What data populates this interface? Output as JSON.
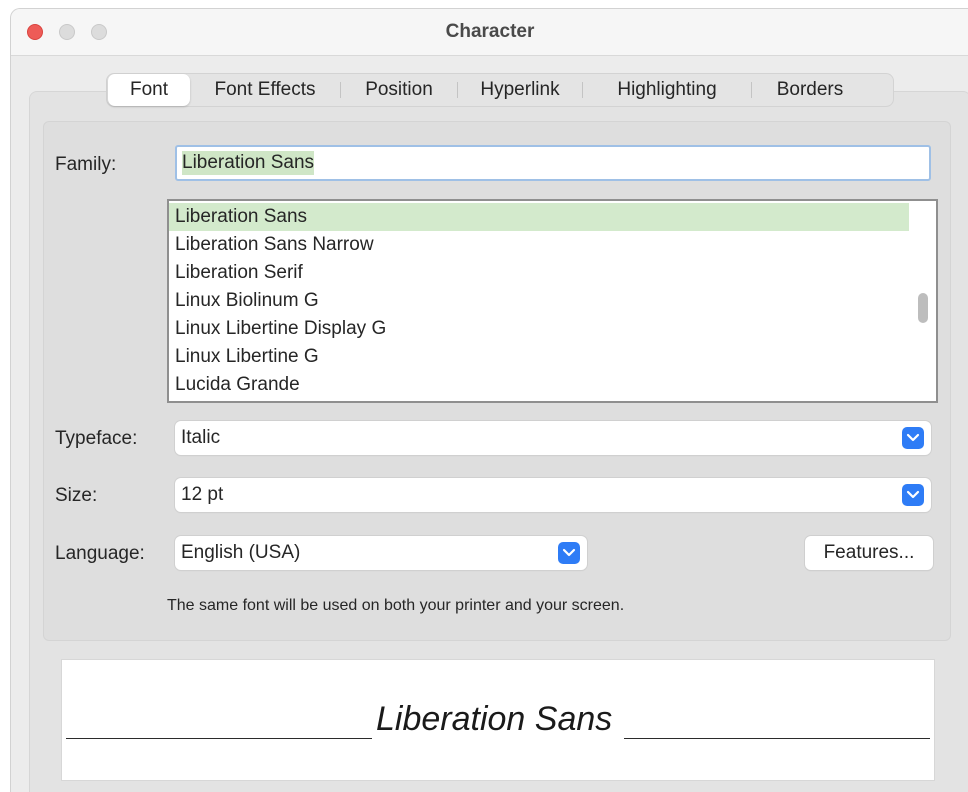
{
  "window": {
    "title": "Character"
  },
  "tabs": [
    {
      "label": "Font",
      "active": true
    },
    {
      "label": "Font Effects",
      "active": false
    },
    {
      "label": "Position",
      "active": false
    },
    {
      "label": "Hyperlink",
      "active": false
    },
    {
      "label": "Highlighting",
      "active": false
    },
    {
      "label": "Borders",
      "active": false
    }
  ],
  "family": {
    "label": "Family:",
    "value": "Liberation Sans",
    "list": [
      "Liberation Sans",
      "Liberation Sans Narrow",
      "Liberation Serif",
      "Linux Biolinum G",
      "Linux Libertine Display G",
      "Linux Libertine G",
      "Lucida Grande"
    ],
    "selected_index": 0
  },
  "typeface": {
    "label": "Typeface:",
    "value": "Italic"
  },
  "size": {
    "label": "Size:",
    "value": "12 pt"
  },
  "language": {
    "label": "Language:",
    "value": "English (USA)"
  },
  "features_button": "Features...",
  "note": "The same font will be used on both your printer and your screen.",
  "preview": {
    "text": "Liberation Sans"
  },
  "colors": {
    "selection_green": "#d3eacc",
    "accent_blue": "#2e7cf6",
    "close_red": "#ee5b57"
  },
  "icons": {
    "close": "close-icon",
    "minimize": "minimize-icon",
    "zoom": "zoom-icon",
    "dropdown": "chevron-down-icon"
  }
}
